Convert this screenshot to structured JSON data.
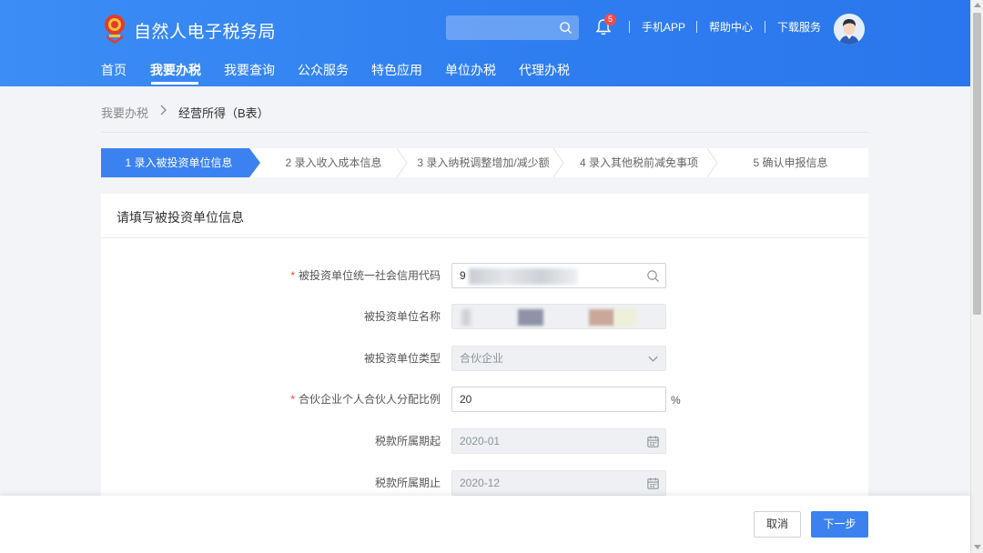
{
  "header": {
    "app_title": "自然人电子税务局",
    "search_placeholder": "",
    "notification_count": "5",
    "links": [
      "手机APP",
      "帮助中心",
      "下载服务"
    ]
  },
  "nav": {
    "items": [
      "首页",
      "我要办税",
      "我要查询",
      "公众服务",
      "特色应用",
      "单位办税",
      "代理办税"
    ],
    "active": "我要办税"
  },
  "breadcrumb": {
    "parent": "我要办税",
    "current": "经营所得（B表）"
  },
  "steps": [
    {
      "label": "1 录入被投资单位信息",
      "active": true
    },
    {
      "label": "2 录入收入成本信息",
      "active": false
    },
    {
      "label": "3 录入纳税调整增加/减少额",
      "active": false
    },
    {
      "label": "4 录入其他税前减免事项",
      "active": false
    },
    {
      "label": "5 确认申报信息",
      "active": false
    }
  ],
  "form": {
    "title": "请填写被投资单位信息",
    "fields": [
      {
        "label": "被投资单位统一社会信用代码",
        "required": true,
        "value": "9",
        "state": "editable",
        "icon": "search-icon"
      },
      {
        "label": "被投资单位名称",
        "required": false,
        "value": "",
        "state": "disabled",
        "icon": ""
      },
      {
        "label": "被投资单位类型",
        "required": false,
        "value": "合伙企业",
        "state": "disabled",
        "icon": "chevron-down-icon"
      },
      {
        "label": "合伙企业个人合伙人分配比例",
        "required": true,
        "value": "20",
        "state": "editable",
        "icon": "",
        "unit": "%"
      },
      {
        "label": "税款所属期起",
        "required": false,
        "value": "2020-01",
        "state": "disabled",
        "icon": "calendar-icon"
      },
      {
        "label": "税款所属期止",
        "required": false,
        "value": "2020-12",
        "state": "disabled",
        "icon": "calendar-icon"
      }
    ]
  },
  "actions": {
    "cancel": "取消",
    "next": "下一步"
  },
  "colors": {
    "header_blue": "#2f7ef0",
    "primary_button": "#3b82f0",
    "required_star": "#f0443a",
    "badge_red": "#f24b4b"
  }
}
